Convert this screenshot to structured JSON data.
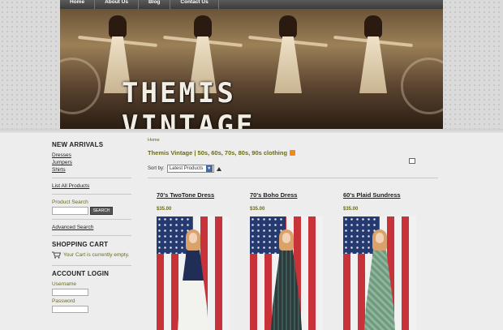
{
  "nav": {
    "items": [
      "Home",
      "About Us",
      "Blog",
      "Contact Us"
    ]
  },
  "banner": {
    "title": "THEMIS VINTAGE"
  },
  "sidebar": {
    "new_arrivals": {
      "heading": "NEW ARRIVALS",
      "links": [
        "Dresses",
        "Jumpers",
        "Shirts"
      ],
      "list_all": "List All Products"
    },
    "search": {
      "label": "Product Search",
      "placeholder": "",
      "button": "SEARCH",
      "advanced": "Advanced Search"
    },
    "cart": {
      "heading": "SHOPPING CART",
      "status": "Your Cart is currently empty."
    },
    "login": {
      "heading": "ACCOUNT LOGIN",
      "username_label": "Username",
      "password_label": "Password"
    }
  },
  "content": {
    "breadcrumb": "Home",
    "category_title": "Themis Vintage | 50s, 60s, 70s, 80s, 90s clothing",
    "sort_label": "Sort by:",
    "sort_value": "Latest Products",
    "products": [
      {
        "name": "70's TwoTone Dress",
        "price": "$35.00",
        "dress_color": "#f2f2ee",
        "top_color": "#1f2d57"
      },
      {
        "name": "70's Boho Dress",
        "price": "$35.00",
        "dress_color": "#2f3a3a",
        "top_color": "#2f3a3a"
      },
      {
        "name": "60's Plaid Sundress",
        "price": "$35.00",
        "dress_color": "#6e9a7e",
        "top_color": "#6e9a7e"
      }
    ]
  },
  "colors": {
    "accent_olive": "#6b6b1a",
    "nav_bg": "#4a4a4a",
    "page_bg": "#ededed"
  }
}
